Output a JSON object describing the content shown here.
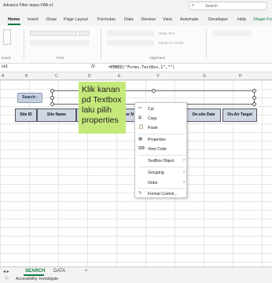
{
  "app": {
    "title": "Advance Filter tanpa VBA-v1",
    "search_placeholder": "Search"
  },
  "ribbon_tabs": [
    "Home",
    "Insert",
    "Draw",
    "Page Layout",
    "Formulas",
    "Data",
    "Review",
    "View",
    "Automate",
    "Developer",
    "Help",
    "Shape Fo"
  ],
  "ribbon": {
    "clipboard_group": "board",
    "font_group": "Font",
    "alignment_group": "Alignment",
    "wrap_text": "Wrap Text",
    "merge_center": "Merge & Center"
  },
  "formula_bar": {
    "name_box": "ox1",
    "fx": "fx",
    "formula": "=EMBED(\"Forms.TextBox.1\",\"\")"
  },
  "columns": [
    "A",
    "B",
    "C",
    "D",
    "E",
    "F",
    "G",
    "H"
  ],
  "sheet": {
    "search_label": "Search :",
    "table_headers": [
      "Site ID",
      "Site Name",
      "On-site Date",
      "On-Air Target"
    ],
    "partial_header": "er N"
  },
  "callout": {
    "text": "Klik kanan pd Textbox lalu pilih properties"
  },
  "context_menu": [
    {
      "label": "Cut",
      "icon": "✂",
      "arrow": ""
    },
    {
      "label": "Copy",
      "icon": "⧉",
      "arrow": ""
    },
    {
      "label": "Paste",
      "icon": "📋",
      "arrow": ""
    },
    {
      "label": "Properties",
      "icon": "▦",
      "arrow": ""
    },
    {
      "label": "View Code",
      "icon": "⌨",
      "arrow": ""
    },
    {
      "label": "TextBox Object",
      "icon": "",
      "arrow": "›"
    },
    {
      "label": "Grouping",
      "icon": "",
      "arrow": "›"
    },
    {
      "label": "Order",
      "icon": "",
      "arrow": "›"
    },
    {
      "label": "Format Control...",
      "icon": "✎",
      "arrow": ""
    }
  ],
  "sheet_tabs": [
    "SEARCH",
    "DATA"
  ],
  "status": {
    "accessibility": "Accessibility: Investigate"
  }
}
